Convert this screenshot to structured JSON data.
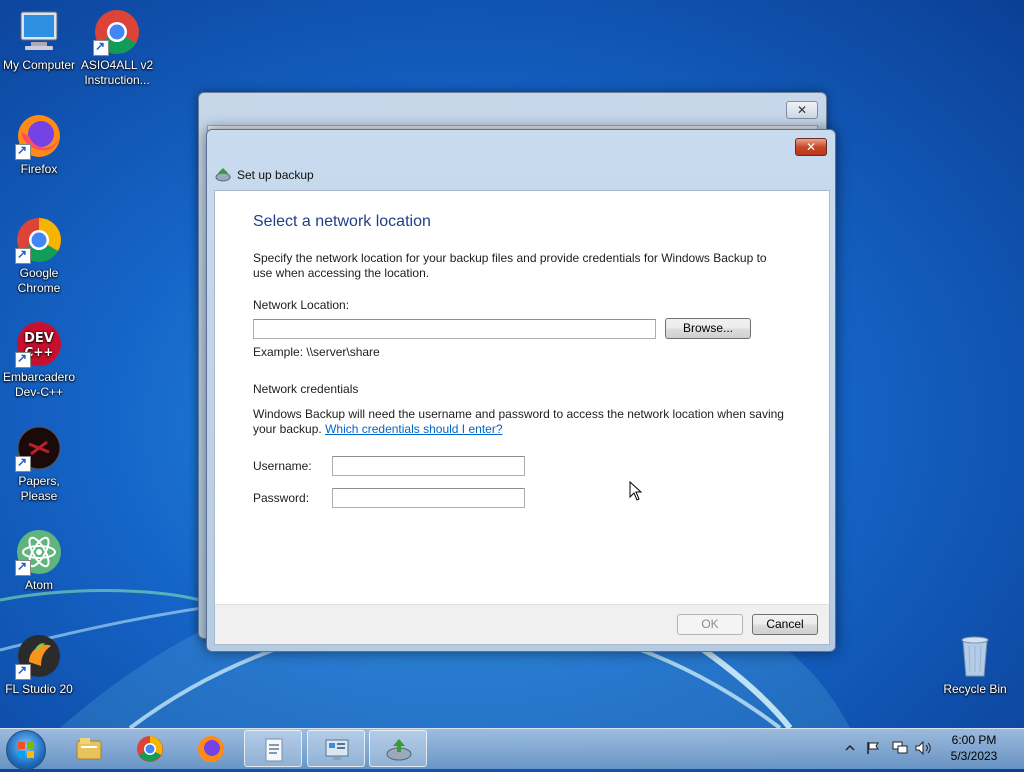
{
  "desktop": {
    "icons": [
      {
        "label": "My Computer"
      },
      {
        "label": "ASIO4ALL v2 Instruction..."
      },
      {
        "label": "Firefox"
      },
      {
        "label": "Google Chrome"
      },
      {
        "label": "Embarcadero Dev-C++"
      },
      {
        "label": "Papers, Please"
      },
      {
        "label": "Atom"
      },
      {
        "label": "FL Studio 20"
      },
      {
        "label": "Recycle Bin"
      }
    ]
  },
  "dialog": {
    "title": "Set up backup",
    "close_label": "✕",
    "heading": "Select a network location",
    "description": "Specify the network location for your backup files and provide credentials for Windows Backup to use when accessing the location.",
    "network_location_label": "Network Location:",
    "network_location_value": "",
    "browse_label": "Browse...",
    "example_text": "Example: \\\\server\\share",
    "credentials_heading": "Network credentials",
    "credentials_text": "Windows Backup will need the username and password to access the network location when saving your backup.",
    "credentials_link": "Which credentials should I enter?",
    "username_label": "Username:",
    "username_value": "",
    "password_label": "Password:",
    "password_value": "",
    "ok_label": "OK",
    "cancel_label": "Cancel"
  },
  "back_window": {
    "close_label": "✕"
  },
  "taskbar": {
    "time": "6:00 PM",
    "date": "5/3/2023",
    "items": [
      "windows-explorer",
      "google-chrome",
      "firefox",
      "document",
      "control-panel",
      "backup"
    ]
  },
  "colors": {
    "heading": "#1e3f8a",
    "link": "#0066cc",
    "close_red": "#c8482a"
  }
}
